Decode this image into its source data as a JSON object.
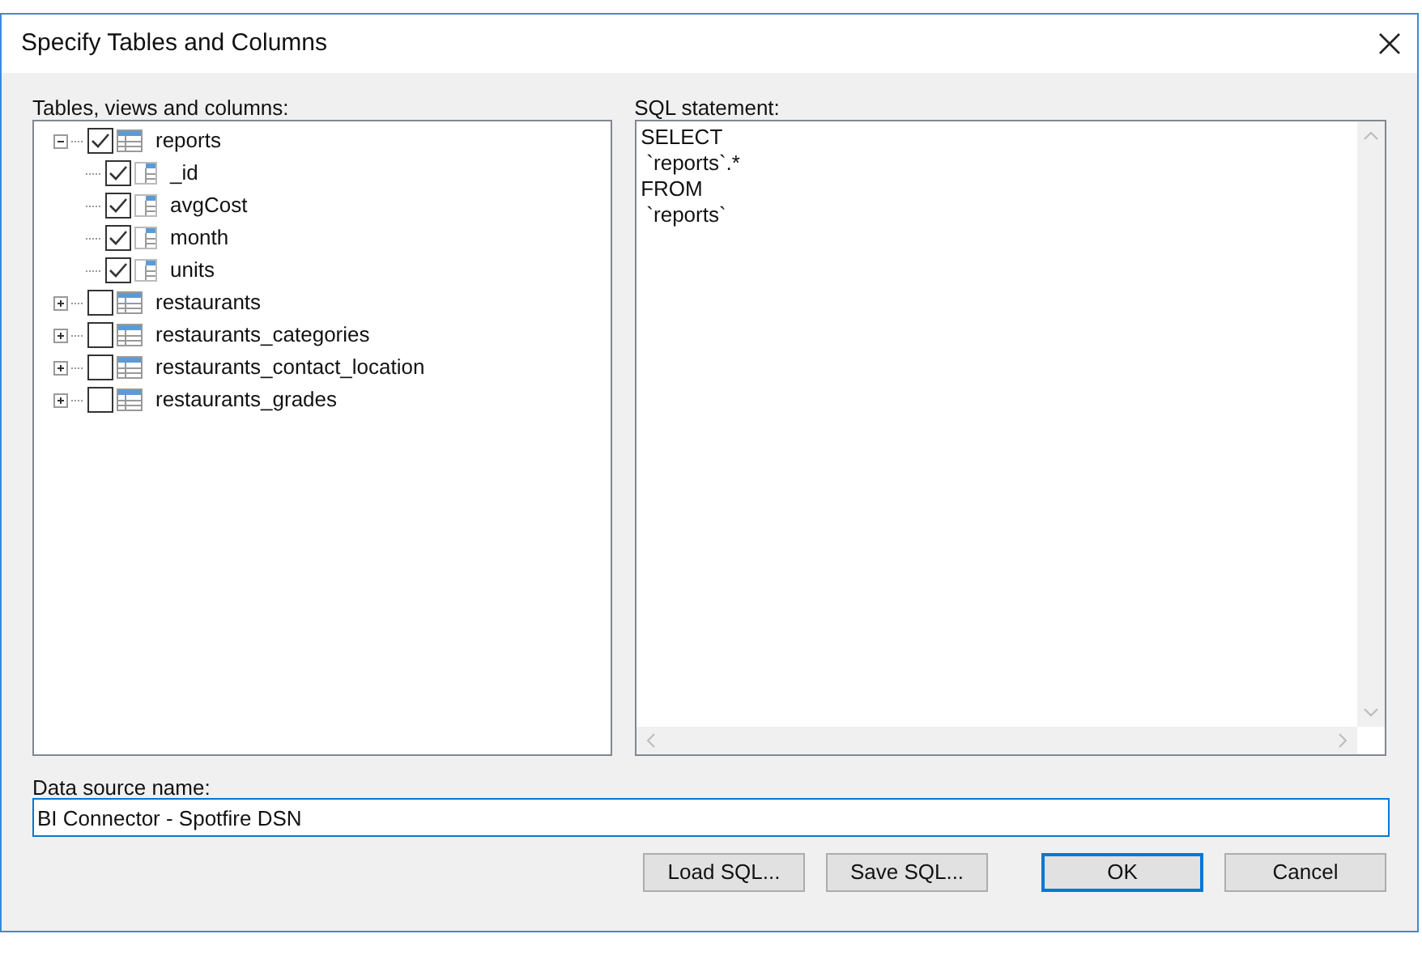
{
  "window": {
    "title": "Specify Tables and Columns"
  },
  "tree": {
    "label": "Tables, views and columns:",
    "items": [
      {
        "label": "reports",
        "checked": true,
        "expanded": true,
        "children": [
          {
            "label": "_id",
            "checked": true
          },
          {
            "label": "avgCost",
            "checked": true
          },
          {
            "label": "month",
            "checked": true
          },
          {
            "label": "units",
            "checked": true
          }
        ]
      },
      {
        "label": "restaurants",
        "checked": false,
        "expanded": false
      },
      {
        "label": "restaurants_categories",
        "checked": false,
        "expanded": false
      },
      {
        "label": "restaurants_contact_location",
        "checked": false,
        "expanded": false
      },
      {
        "label": "restaurants_grades",
        "checked": false,
        "expanded": false
      }
    ]
  },
  "sql": {
    "label": "SQL statement:",
    "lines": [
      "SELECT",
      " `reports`.*",
      "FROM",
      " `reports`"
    ]
  },
  "data_source": {
    "label": "Data source name:",
    "value": "BI Connector - Spotfire DSN"
  },
  "buttons": [
    {
      "label": "Load SQL...",
      "default": false
    },
    {
      "label": "Save SQL...",
      "default": false
    },
    {
      "label": "OK",
      "default": true
    },
    {
      "label": "Cancel",
      "default": false
    }
  ]
}
